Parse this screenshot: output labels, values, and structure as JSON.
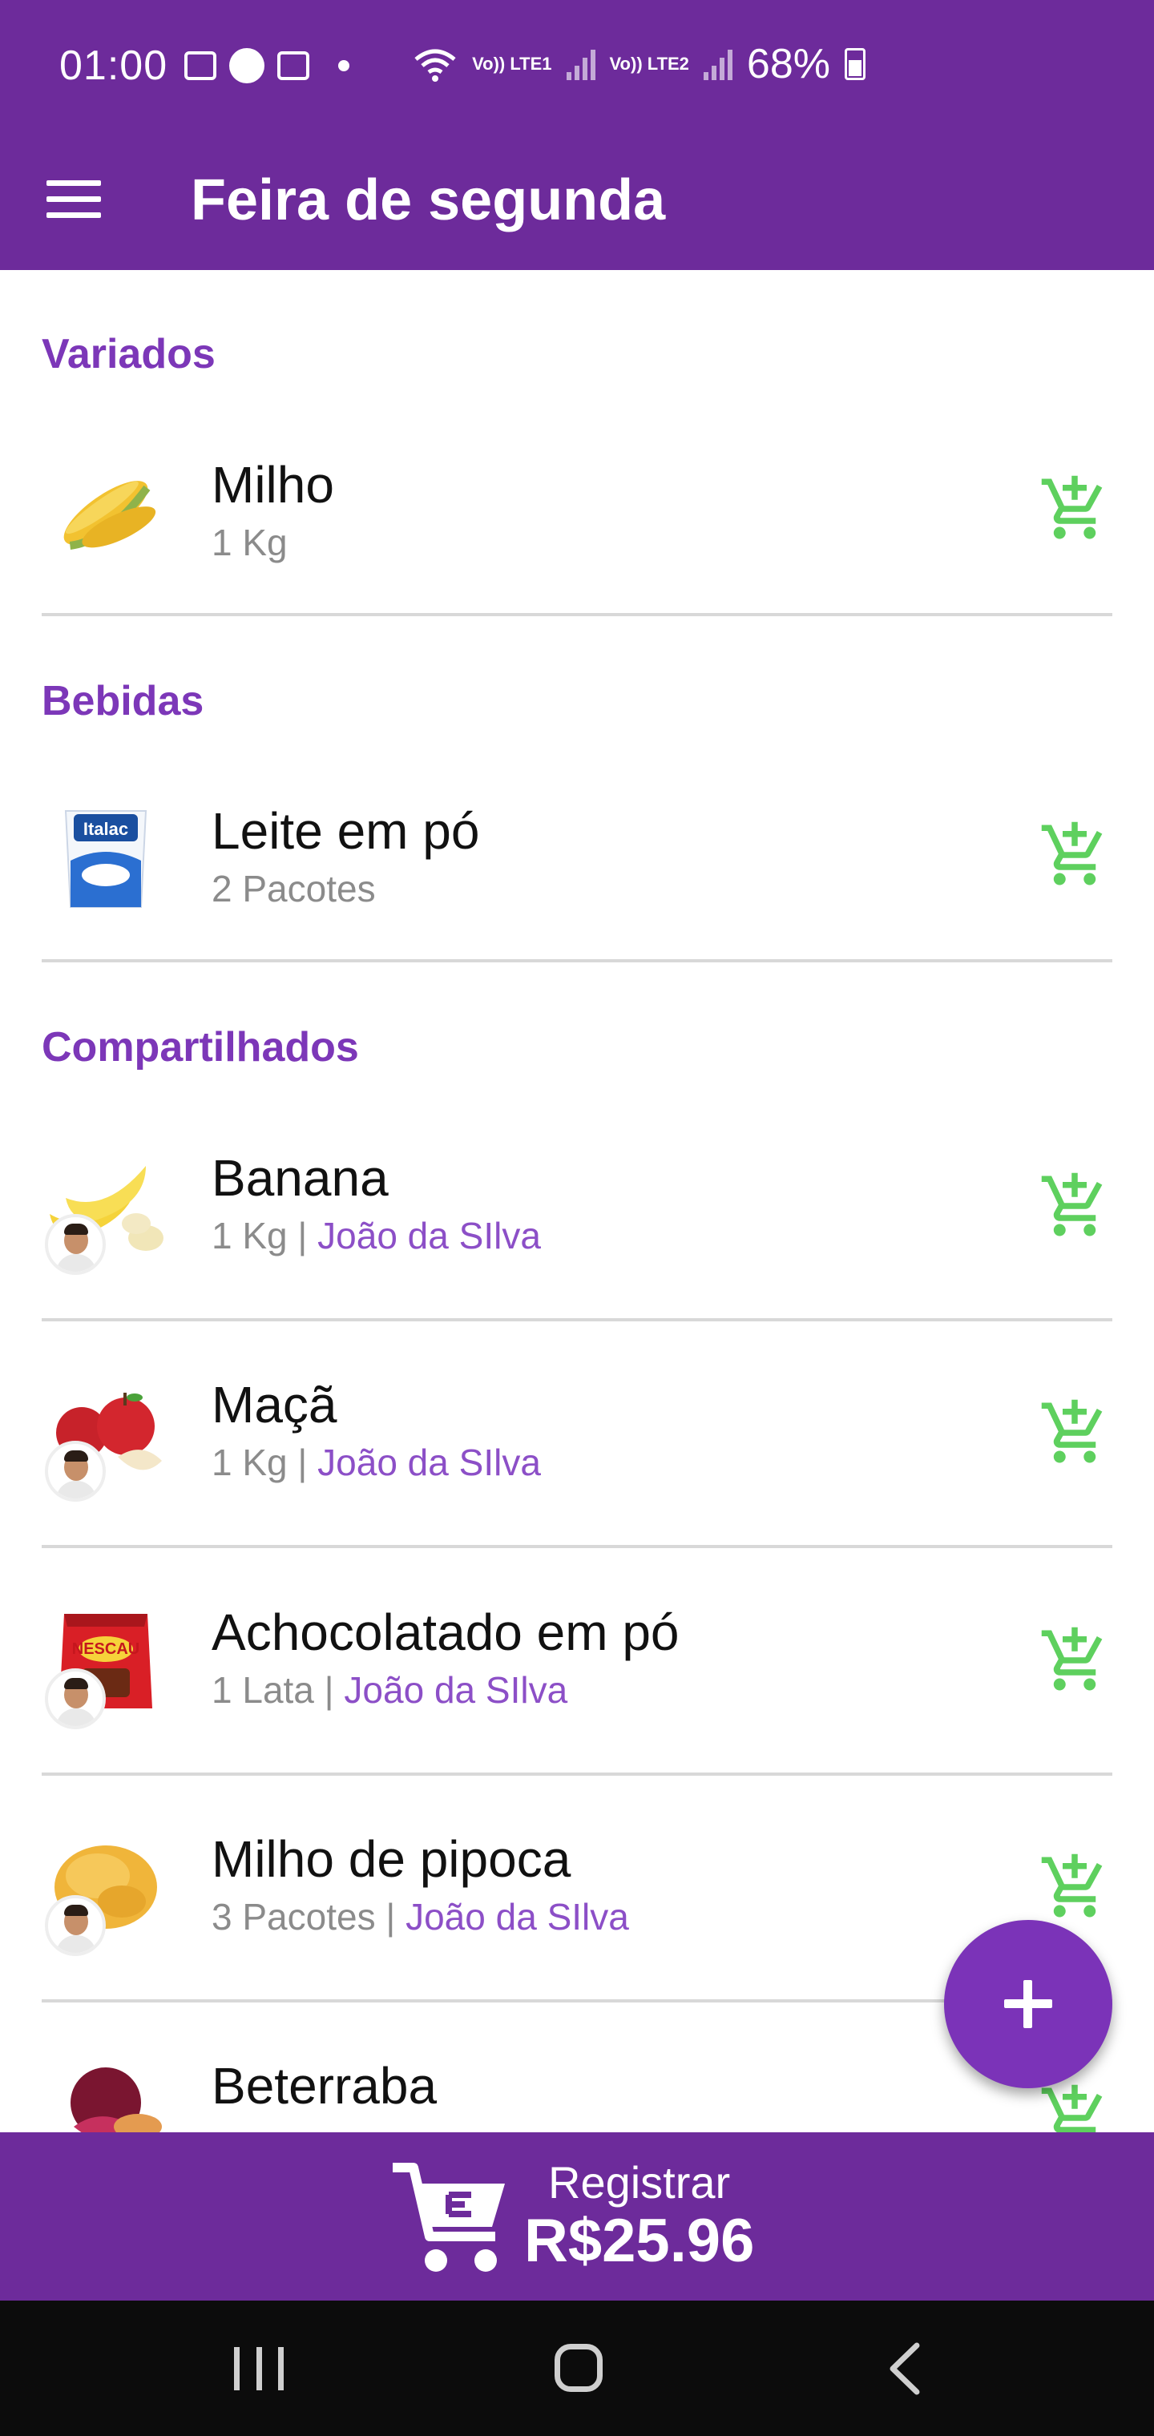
{
  "status_bar": {
    "time": "01:00",
    "battery": "68%",
    "sim1": "Vo)) LTE1",
    "sim2": "Vo)) LTE2",
    "icons": [
      "image-icon",
      "app-icon",
      "mail-icon",
      "dot-icon",
      "wifi-icon",
      "signal-icon",
      "battery-icon"
    ]
  },
  "app_bar": {
    "title": "Feira de segunda",
    "menu_icon": "hamburger-menu-icon"
  },
  "sections": [
    {
      "title": "Variados",
      "items": [
        {
          "name": "Milho",
          "quantity": "1 Kg",
          "owner": "",
          "image": "corn"
        }
      ]
    },
    {
      "title": "Bebidas",
      "items": [
        {
          "name": "Leite em pó",
          "quantity": "2 Pacotes",
          "owner": "",
          "image": "milk-powder"
        }
      ]
    },
    {
      "title": "Compartilhados",
      "items": [
        {
          "name": "Banana",
          "quantity": "1 Kg",
          "separator": " | ",
          "owner": "João da SIlva",
          "image": "banana"
        },
        {
          "name": "Maçã",
          "quantity": "1 Kg",
          "separator": " | ",
          "owner": "João da SIlva",
          "image": "apple"
        },
        {
          "name": "Achocolatado em pó",
          "quantity": "1 Lata",
          "separator": " | ",
          "owner": "João da SIlva",
          "image": "chocolate-powder"
        },
        {
          "name": "Milho de pipoca",
          "quantity": "3 Pacotes",
          "separator": " | ",
          "owner": "João da SIlva",
          "image": "popcorn"
        },
        {
          "name": "Beterraba",
          "quantity": "",
          "owner": "",
          "image": "beet"
        }
      ]
    }
  ],
  "fab": {
    "icon": "plus-icon"
  },
  "register": {
    "label": "Registrar",
    "total": "R$25.96",
    "icon": "cart-register-icon"
  },
  "colors": {
    "primary": "#6d2b9b",
    "accent": "#7c37b8",
    "cart_green": "#5ed05e",
    "owner_text": "#8c4fc7"
  }
}
